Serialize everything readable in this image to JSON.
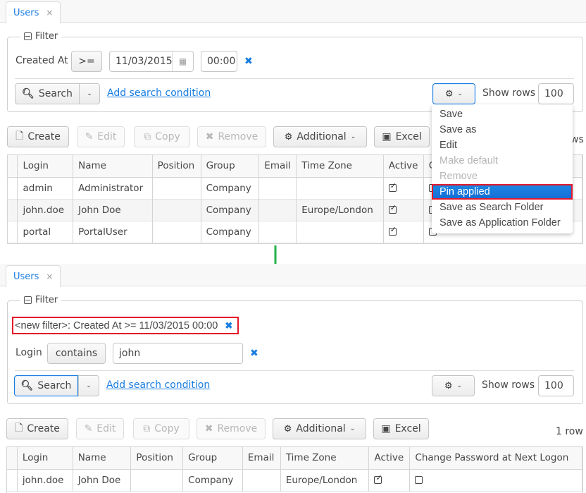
{
  "top": {
    "tab": {
      "label": "Users",
      "close": "×"
    },
    "filter": {
      "legend": "Filter",
      "condition": {
        "field": "Created At",
        "operator": ">=",
        "date": "11/03/2015",
        "time": "00:00"
      },
      "search_label": "Search",
      "add_condition_label": "Add search condition",
      "show_rows_label": "Show rows",
      "show_rows_value": "100"
    },
    "toolbar": {
      "create": "Create",
      "edit": "Edit",
      "copy": "Copy",
      "remove": "Remove",
      "additional": "Additional",
      "excel": "Excel",
      "row_count_partial": "ws"
    },
    "table": {
      "columns": [
        "Login",
        "Name",
        "Position",
        "Group",
        "Email",
        "Time Zone",
        "Active",
        "C"
      ],
      "rows": [
        {
          "login": "admin",
          "name": "Administrator",
          "position": "",
          "group": "Company",
          "email": "",
          "timezone": "",
          "active": true,
          "change_pwd": false
        },
        {
          "login": "john.doe",
          "name": "John Doe",
          "position": "",
          "group": "Company",
          "email": "",
          "timezone": "Europe/London",
          "active": true,
          "change_pwd": false
        },
        {
          "login": "portal",
          "name": "PortalUser",
          "position": "",
          "group": "Company",
          "email": "",
          "timezone": "",
          "active": true,
          "change_pwd": false
        }
      ]
    },
    "settings_menu": {
      "items": [
        {
          "label": "Save",
          "state": "enabled"
        },
        {
          "label": "Save as",
          "state": "enabled"
        },
        {
          "label": "Edit",
          "state": "enabled"
        },
        {
          "label": "Make default",
          "state": "disabled"
        },
        {
          "label": "Remove",
          "state": "disabled"
        },
        {
          "label": "Pin applied",
          "state": "highlighted"
        },
        {
          "label": "Save as Search Folder",
          "state": "enabled"
        },
        {
          "label": "Save as Application Folder",
          "state": "enabled"
        }
      ]
    }
  },
  "bottom": {
    "tab": {
      "label": "Users",
      "close": "×"
    },
    "filter": {
      "legend": "Filter",
      "applied_summary": "<new filter>: Created At >= 11/03/2015 00:00",
      "condition": {
        "field": "Login",
        "operator": "contains",
        "value": "john"
      },
      "search_label": "Search",
      "add_condition_label": "Add search condition",
      "show_rows_label": "Show rows",
      "show_rows_value": "100"
    },
    "toolbar": {
      "create": "Create",
      "edit": "Edit",
      "copy": "Copy",
      "remove": "Remove",
      "additional": "Additional",
      "excel": "Excel",
      "row_count": "1 row"
    },
    "table": {
      "columns": [
        "Login",
        "Name",
        "Position",
        "Group",
        "Email",
        "Time Zone",
        "Active",
        "Change Password at Next Logon"
      ],
      "rows": [
        {
          "login": "john.doe",
          "name": "John Doe",
          "position": "",
          "group": "Company",
          "email": "",
          "timezone": "Europe/London",
          "active": true,
          "change_pwd": false
        }
      ]
    }
  },
  "colors": {
    "accent": "#197de1",
    "highlight_border": "#e3192a",
    "arrow": "#22b14c"
  }
}
